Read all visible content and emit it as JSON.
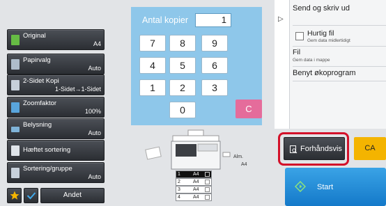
{
  "copies": {
    "label": "Antal kopier",
    "value": "1"
  },
  "keypad": {
    "keys": [
      "7",
      "8",
      "9",
      "4",
      "5",
      "6",
      "1",
      "2",
      "3",
      "0"
    ],
    "clear": "C"
  },
  "functions": [
    {
      "name": "original",
      "label": "Original",
      "value": "A4",
      "icon": "original-icon",
      "color": "#66bb44"
    },
    {
      "name": "papirvalg",
      "label": "Papirvalg",
      "value": "Auto",
      "icon": "paper-icon",
      "color": "#aebccb"
    },
    {
      "name": "duplex",
      "label": "2-Sidet Kopi",
      "value": "1-Sidet→1-Sidet",
      "icon": "duplex-icon",
      "color": "#c7d0da"
    },
    {
      "name": "zoom",
      "label": "Zoomfaktor",
      "value": "100%",
      "icon": "zoom-icon",
      "color": "#59a5dc"
    },
    {
      "name": "belysning",
      "label": "Belysning",
      "value": "Auto",
      "icon": "exposure-icon",
      "color": "#7fb3d8"
    },
    {
      "name": "haeftet",
      "label": "Hæftet sortering",
      "value": "",
      "icon": "staple-sort-icon",
      "color": "#dfe4ea"
    },
    {
      "name": "sortering",
      "label": "Sortering/gruppe",
      "value": "Auto",
      "icon": "sort-group-icon",
      "color": "#c7d0da"
    }
  ],
  "bottom_bar": {
    "favorite_icon": "star-icon",
    "check_icon": "check-icon",
    "other_label": "Andet"
  },
  "trays": [
    {
      "num": "1",
      "size": "A4",
      "active": true
    },
    {
      "num": "2",
      "size": "A4",
      "active": false
    },
    {
      "num": "3",
      "size": "A4",
      "active": false
    },
    {
      "num": "4",
      "size": "A4",
      "active": false
    }
  ],
  "bypass": {
    "label": "Alm.",
    "size": "A4"
  },
  "right_panel": {
    "title": "Send og skriv ud",
    "quick_file_title": "Hurtig fil",
    "quick_file_sub": "Gem data midlertidigt",
    "file_title": "Fil",
    "file_sub": "Gem data i mappe",
    "eco_title": "Benyt økoprogram"
  },
  "actions": {
    "preview": "Forhåndsvis",
    "ca": "CA",
    "start": "Start"
  },
  "colors": {
    "keypad_bg": "#8ec7ea",
    "clear_key": "#e56c9b",
    "ca_button": "#f4b400",
    "start_button": "#1e8ad8",
    "highlight": "#d3112a"
  }
}
